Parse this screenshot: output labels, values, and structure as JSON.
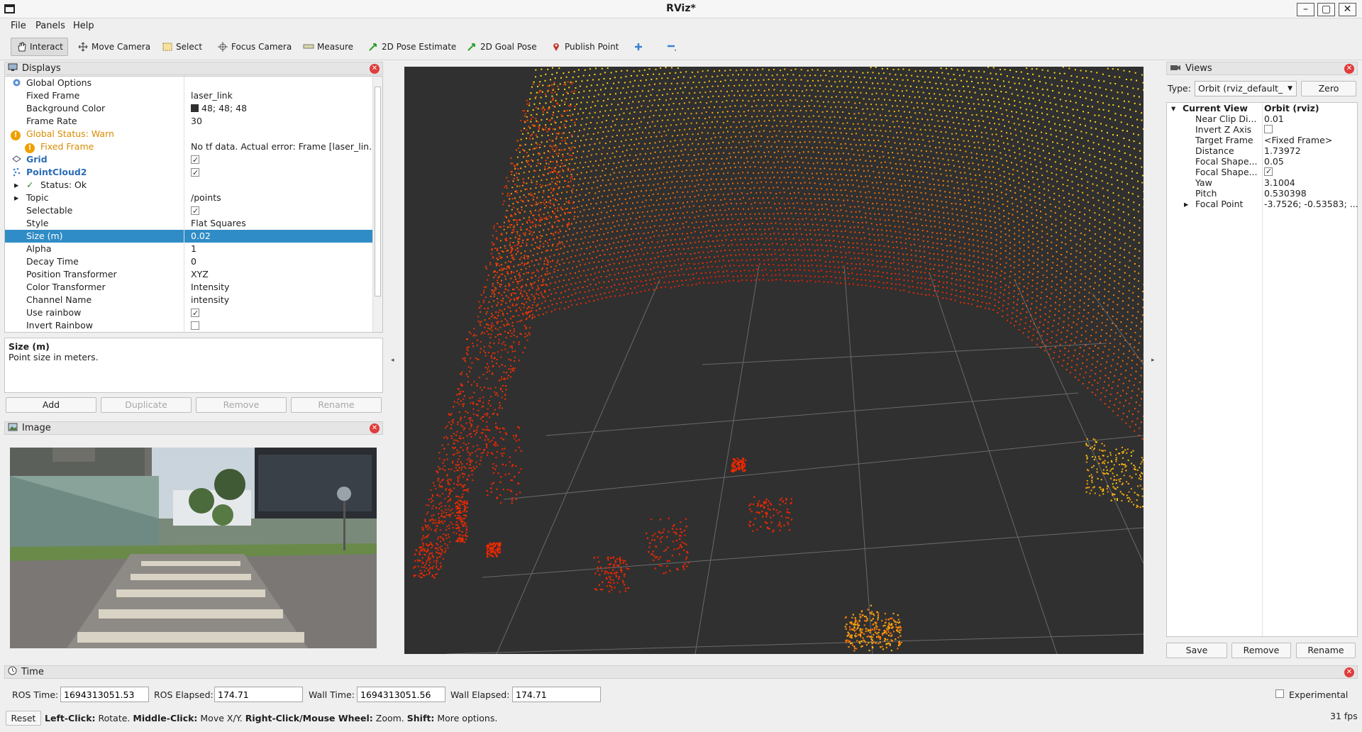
{
  "window": {
    "title": "RViz*"
  },
  "menu": [
    "File",
    "Panels",
    "Help"
  ],
  "toolbar": {
    "interact": "Interact",
    "move_camera": "Move Camera",
    "select": "Select",
    "focus_camera": "Focus Camera",
    "measure": "Measure",
    "pose_estimate": "2D Pose Estimate",
    "goal_pose": "2D Goal Pose",
    "publish_point": "Publish Point"
  },
  "displays": {
    "title": "Displays",
    "rows": [
      {
        "label": "Global Options",
        "value": ""
      },
      {
        "label": "Fixed Frame",
        "value": "laser_link"
      },
      {
        "label": "Background Color",
        "value": "48; 48; 48"
      },
      {
        "label": "Frame Rate",
        "value": "30"
      },
      {
        "label": "Global Status: Warn",
        "value": ""
      },
      {
        "label": "Fixed Frame",
        "value": "No tf data.  Actual error: Frame [laser_lin..."
      },
      {
        "label": "Grid",
        "value": ""
      },
      {
        "label": "PointCloud2",
        "value": ""
      },
      {
        "label": "Status: Ok",
        "value": ""
      },
      {
        "label": "Topic",
        "value": "/points"
      },
      {
        "label": "Selectable",
        "value": ""
      },
      {
        "label": "Style",
        "value": "Flat Squares"
      },
      {
        "label": "Size (m)",
        "value": "0.02"
      },
      {
        "label": "Alpha",
        "value": "1"
      },
      {
        "label": "Decay Time",
        "value": "0"
      },
      {
        "label": "Position Transformer",
        "value": "XYZ"
      },
      {
        "label": "Color Transformer",
        "value": "Intensity"
      },
      {
        "label": "Channel Name",
        "value": "intensity"
      },
      {
        "label": "Use rainbow",
        "value": ""
      },
      {
        "label": "Invert Rainbow",
        "value": ""
      }
    ],
    "desc_title": "Size (m)",
    "desc_text": "Point size in meters.",
    "buttons": {
      "add": "Add",
      "duplicate": "Duplicate",
      "remove": "Remove",
      "rename": "Rename"
    }
  },
  "image_panel": {
    "title": "Image"
  },
  "views": {
    "title": "Views",
    "type_label": "Type:",
    "type_value": "Orbit (rviz_default_",
    "zero": "Zero",
    "rows": [
      {
        "label": "Current View",
        "value": "Orbit (rviz)"
      },
      {
        "label": "Near Clip Di...",
        "value": "0.01"
      },
      {
        "label": "Invert Z Axis",
        "value": ""
      },
      {
        "label": "Target Frame",
        "value": "<Fixed Frame>"
      },
      {
        "label": "Distance",
        "value": "1.73972"
      },
      {
        "label": "Focal Shape...",
        "value": "0.05"
      },
      {
        "label": "Focal Shape...",
        "value": ""
      },
      {
        "label": "Yaw",
        "value": "3.1004"
      },
      {
        "label": "Pitch",
        "value": "0.530398"
      },
      {
        "label": "Focal Point",
        "value": "-3.7526; -0.53583; ..."
      }
    ],
    "buttons": {
      "save": "Save",
      "remove": "Remove",
      "rename": "Rename"
    }
  },
  "time": {
    "title": "Time",
    "ros_time_label": "ROS Time:",
    "ros_time": "1694313051.53",
    "ros_elapsed_label": "ROS Elapsed:",
    "ros_elapsed": "174.71",
    "wall_time_label": "Wall Time:",
    "wall_time": "1694313051.56",
    "wall_elapsed_label": "Wall Elapsed:",
    "wall_elapsed": "174.71",
    "experimental": "Experimental"
  },
  "status": {
    "reset": "Reset",
    "hint_1b": "Left-Click:",
    "hint_1": " Rotate. ",
    "hint_2b": "Middle-Click:",
    "hint_2": " Move X/Y. ",
    "hint_3b": "Right-Click/Mouse Wheel:",
    "hint_3": " Zoom. ",
    "hint_4b": "Shift:",
    "hint_4": " More options.",
    "fps": "31 fps"
  },
  "colors": {
    "viewport_bg": "#303030",
    "selection": "#308cc6",
    "warn": "#d98b00"
  }
}
